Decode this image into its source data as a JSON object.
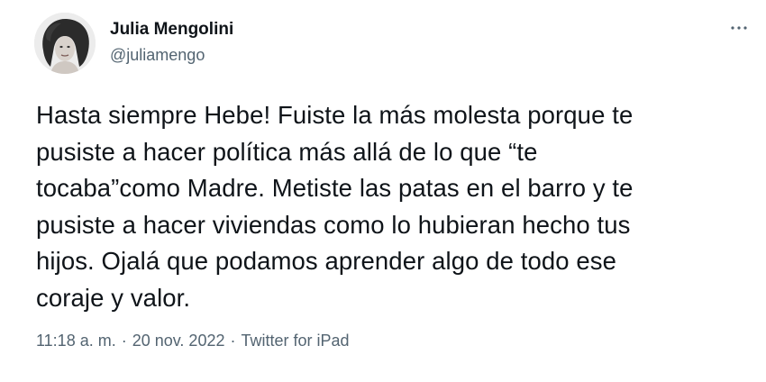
{
  "author": {
    "display_name": "Julia Mengolini",
    "handle": "@juliamengo"
  },
  "icons": {
    "more": "more-horizontal-icon",
    "avatar": "profile-photo"
  },
  "tweet": {
    "text": "Hasta siempre Hebe! Fuiste la más molesta porque te\npusiste a hacer política más allá de lo que “te\ntocaba”como Madre. Metiste las patas en el barro y te\npusiste a hacer viviendas como lo hubieran hecho tus\nhijos. Ojalá que podamos aprender algo de todo ese\ncoraje y valor."
  },
  "meta": {
    "time": "11:18 a. m.",
    "separator": "·",
    "date": "20 nov. 2022",
    "source": "Twitter for iPad"
  },
  "colors": {
    "text": "#0f1419",
    "secondary": "#536471"
  }
}
